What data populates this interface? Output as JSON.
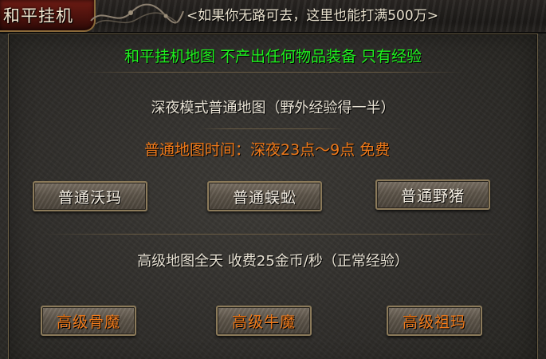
{
  "window": {
    "title": "和平挂机",
    "hint": "<如果你无路可去，这里也能打满500万>"
  },
  "panel": {
    "banner": "和平挂机地图  不产出任何物品装备  只有经验",
    "normal_section": {
      "title": "深夜模式普通地图（野外经验得一半）",
      "time_note": "普通地图时间：深夜23点～9点 免费",
      "buttons": [
        "普通沃玛",
        "普通蜈蚣",
        "普通野猪"
      ]
    },
    "advanced_section": {
      "title": "高级地图全天  收费25金币/秒（正常经验）",
      "buttons": [
        "高级骨魔",
        "高级牛魔",
        "高级祖玛"
      ]
    }
  },
  "colors": {
    "banner": "#1ef41e",
    "highlight": "#f07a1a",
    "text": "#e8e2d4",
    "title_tab": "#6d1c14"
  }
}
